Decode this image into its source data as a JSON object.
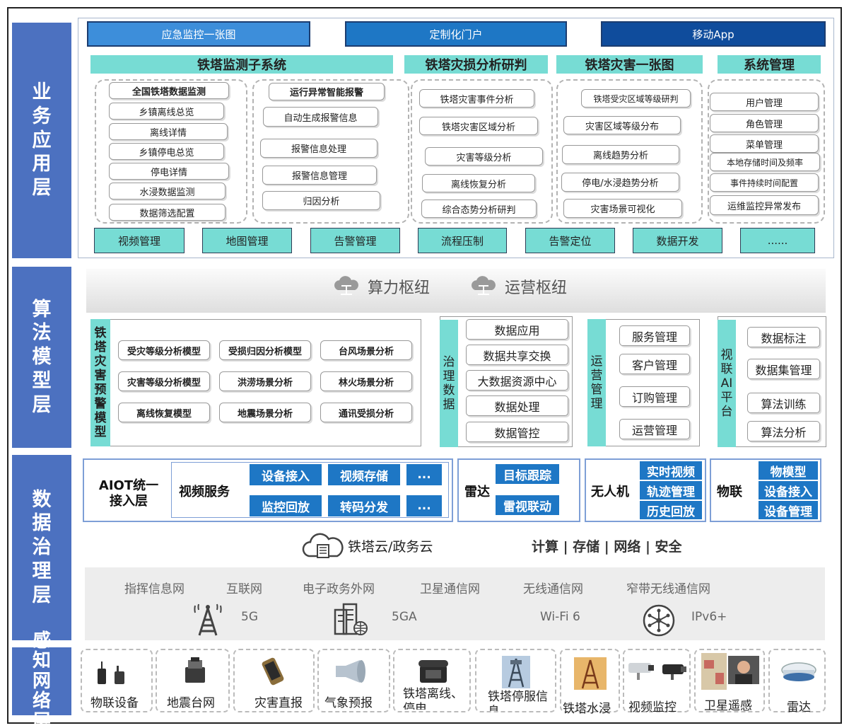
{
  "layers": {
    "business": "业务应用层",
    "algorithm": "算法模型层",
    "data": "数据治理层",
    "sensing": "感知网络层"
  },
  "top_tabs": [
    "应急监控一张图",
    "定制化门户",
    "移动App"
  ],
  "subsystems": {
    "monitoring": {
      "title": "铁塔监测子系统",
      "col1": [
        "全国铁塔数据监测",
        "乡镇离线总览",
        "离线详情",
        "乡镇停电总览",
        "停电详情",
        "水浸数据监测",
        "数据筛选配置"
      ],
      "col2": [
        "运行异常智能报警",
        "自动生成报警信息",
        "报警信息处理",
        "报警信息管理",
        "归因分析"
      ]
    },
    "damage": {
      "title": "铁塔灾损分析研判",
      "items": [
        "铁塔灾害事件分析",
        "铁塔灾害区域分析",
        "灾害等级分析",
        "离线恢复分析",
        "综合态势分析研判"
      ]
    },
    "map": {
      "title": "铁塔灾害一张图",
      "items": [
        "铁塔受灾区域等级研判",
        "灾害区域等级分布",
        "离线趋势分析",
        "停电/水浸趋势分析",
        "灾害场景可视化"
      ]
    },
    "system": {
      "title": "系统管理",
      "items": [
        "用户管理",
        "角色管理",
        "菜单管理",
        "本地存储时间及频率",
        "事件持续时间配置",
        "运维监控异常发布"
      ]
    }
  },
  "bottom_buttons": [
    "视频管理",
    "地图管理",
    "告警管理",
    "流程压制",
    "告警定位",
    "数据开发",
    "......"
  ],
  "hubs": {
    "compute": "算力枢纽",
    "operation": "运营枢纽"
  },
  "warning_models": {
    "title": "铁塔灾害预警模型",
    "items": [
      "受灾等级分析模型",
      "受损归因分析模型",
      "台风场景分析",
      "灾害等级分析模型",
      "洪涝场景分析",
      "林火场景分析",
      "离线恢复模型",
      "地震场景分析",
      "通讯受损分析"
    ]
  },
  "governance": {
    "title": "治理数据",
    "items": [
      "数据应用",
      "数据共享交换",
      "大数据资源中心",
      "数据处理",
      "数据管控"
    ]
  },
  "operations": {
    "title": "运营管理",
    "items": [
      "服务管理",
      "客户管理",
      "订购管理",
      "运营管理"
    ]
  },
  "ai_platform": {
    "title": "视联AI平台",
    "items": [
      "数据标注",
      "数据集管理",
      "算法训练",
      "算法分析"
    ]
  },
  "aiot": {
    "title": "AIOT统一接入层",
    "video_title": "视频服务",
    "video_items": [
      "设备接入",
      "视频存储",
      "...",
      "监控回放",
      "转码分发",
      "..."
    ]
  },
  "radar": {
    "title": "雷达",
    "items": [
      "目标跟踪",
      "雷视联动"
    ]
  },
  "drone": {
    "title": "无人机",
    "items": [
      "实时视频",
      "轨迹管理",
      "历史回放"
    ]
  },
  "iot": {
    "title": "物联",
    "items": [
      "物模型",
      "设备接入",
      "设备管理"
    ]
  },
  "cloud": {
    "label": "铁塔云/政务云",
    "services": "计算 | 存储 | 网络 | 安全"
  },
  "networks": {
    "names": [
      "指挥信息网",
      "互联网",
      "电子政务外网",
      "卫星通信网",
      "无线通信网",
      "窄带无线通信网"
    ],
    "tech": [
      "5G",
      "5GA",
      "Wi-Fi 6",
      "IPv6+"
    ]
  },
  "sensors": [
    "物联设备",
    "地震台网",
    "灾害直报",
    "气象预报",
    "铁塔离线、停电",
    "铁塔停服信息",
    "铁塔水浸",
    "视频监控",
    "卫星遥感",
    "雷达"
  ],
  "colors": {
    "layer_blue": "#4C71C0",
    "teal": "#77DCD4",
    "tab_blue": "#1E77C5",
    "tab_navy": "#0F4C9C"
  }
}
